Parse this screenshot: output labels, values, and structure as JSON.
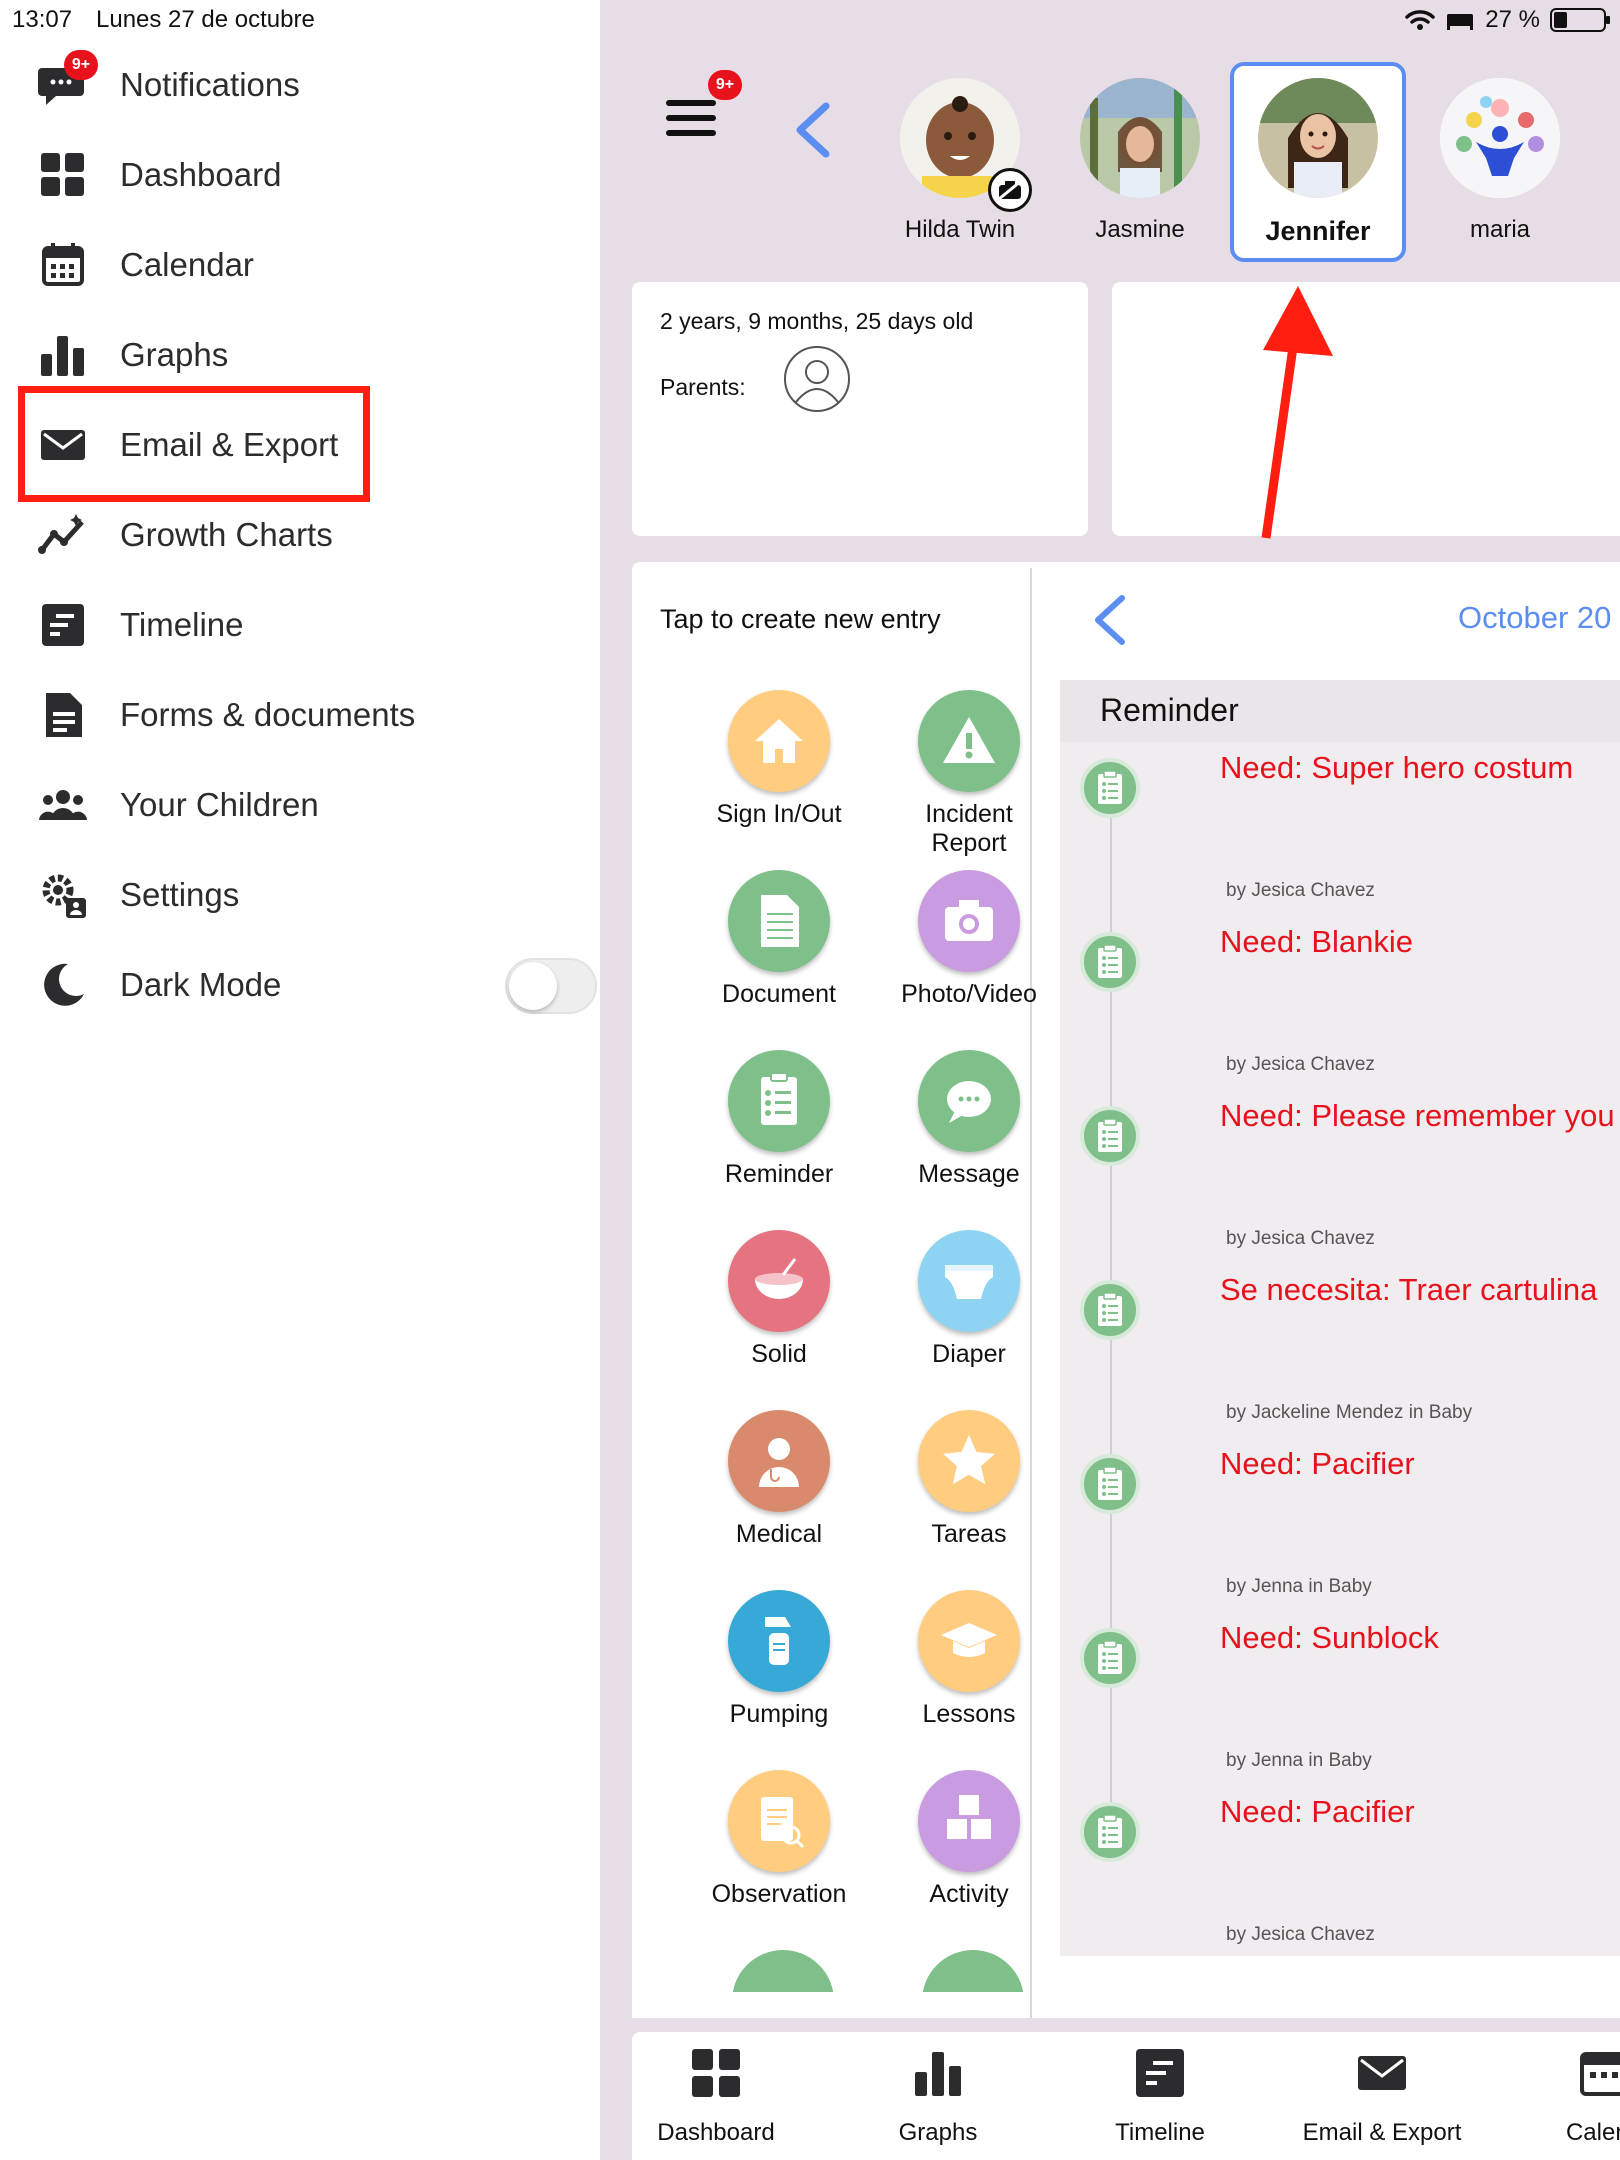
{
  "status_bar": {
    "time": "13:07",
    "date": "Lunes 27 de octubre",
    "battery": "27 %",
    "battery_level": 0.27
  },
  "sidebar": {
    "notifications_badge": "9+",
    "items": [
      {
        "label": "Notifications",
        "icon": "chat-bubble-icon"
      },
      {
        "label": "Dashboard",
        "icon": "grid-icon"
      },
      {
        "label": "Calendar",
        "icon": "calendar-icon"
      },
      {
        "label": "Graphs",
        "icon": "bar-chart-icon"
      },
      {
        "label": "Email & Export",
        "icon": "envelope-icon"
      },
      {
        "label": "Growth Charts",
        "icon": "growth-chart-icon"
      },
      {
        "label": "Timeline",
        "icon": "timeline-icon"
      },
      {
        "label": "Forms & documents",
        "icon": "document-icon"
      },
      {
        "label": "Your Children",
        "icon": "group-icon"
      },
      {
        "label": "Settings",
        "icon": "gear-person-icon"
      },
      {
        "label": "Dark Mode",
        "icon": "moon-icon"
      }
    ],
    "dark_mode_on": false,
    "highlight_color": "#ff1e10"
  },
  "header": {
    "menu_badge": "9+",
    "children": [
      {
        "name": "Hilda Twin",
        "selected": false
      },
      {
        "name": "Jasmine",
        "selected": false
      },
      {
        "name": "Jennifer",
        "selected": true
      },
      {
        "name": "maria",
        "selected": false
      }
    ]
  },
  "profile": {
    "age": "2 years, 9 months, 25 days old",
    "parents_label": "Parents:"
  },
  "entries": {
    "title": "Tap to create new entry",
    "items": [
      {
        "label": "Sign In/Out",
        "color": "#ffcc80",
        "icon": "house-icon"
      },
      {
        "label": "Incident Report",
        "color": "#7fbf8a",
        "icon": "warning-icon"
      },
      {
        "label": "Document",
        "color": "#7fbf8a",
        "icon": "document-icon"
      },
      {
        "label": "Photo/Video",
        "color": "#c99be0",
        "icon": "camera-icon"
      },
      {
        "label": "Reminder",
        "color": "#7fbf8a",
        "icon": "checklist-icon"
      },
      {
        "label": "Message",
        "color": "#7fbf8a",
        "icon": "speech-bubble-icon"
      },
      {
        "label": "Solid",
        "color": "#e57380",
        "icon": "bowl-icon"
      },
      {
        "label": "Diaper",
        "color": "#8fd3f2",
        "icon": "diaper-icon"
      },
      {
        "label": "Medical",
        "color": "#d98a6c",
        "icon": "doctor-icon"
      },
      {
        "label": "Tareas",
        "color": "#ffcc80",
        "icon": "star-icon"
      },
      {
        "label": "Pumping",
        "color": "#36a9d6",
        "icon": "pump-icon"
      },
      {
        "label": "Lessons",
        "color": "#ffcc80",
        "icon": "graduation-cap-icon"
      },
      {
        "label": "Observation",
        "color": "#ffcc80",
        "icon": "clipboard-search-icon"
      },
      {
        "label": "Activity",
        "color": "#c99be0",
        "icon": "blocks-icon"
      }
    ]
  },
  "timeline": {
    "month": "October 20",
    "section": "Reminder",
    "items": [
      {
        "title": "Need: Super hero costum",
        "by": "by Jesica Chavez"
      },
      {
        "title": "Need: Blankie",
        "by": "by Jesica Chavez"
      },
      {
        "title": "Need: Please remember you",
        "by": "by Jesica Chavez"
      },
      {
        "title": "Se necesita: Traer cartulina",
        "by": "by Jackeline Mendez in Baby"
      },
      {
        "title": "Need: Pacifier",
        "by": "by Jenna in Baby"
      },
      {
        "title": "Need: Sunblock",
        "by": "by Jenna in Baby"
      },
      {
        "title": "Need: Pacifier",
        "by": "by Jesica Chavez"
      }
    ]
  },
  "bottom_tabs": [
    {
      "label": "Dashboard",
      "icon": "grid-icon"
    },
    {
      "label": "Graphs",
      "icon": "bar-chart-icon"
    },
    {
      "label": "Timeline",
      "icon": "timeline-icon"
    },
    {
      "label": "Email & Export",
      "icon": "envelope-icon"
    },
    {
      "label": "Calend",
      "icon": "calendar-icon"
    }
  ],
  "colors": {
    "accent_blue": "#5b8ef0",
    "alert_red": "#e8121c",
    "background": "#e7dde6"
  }
}
